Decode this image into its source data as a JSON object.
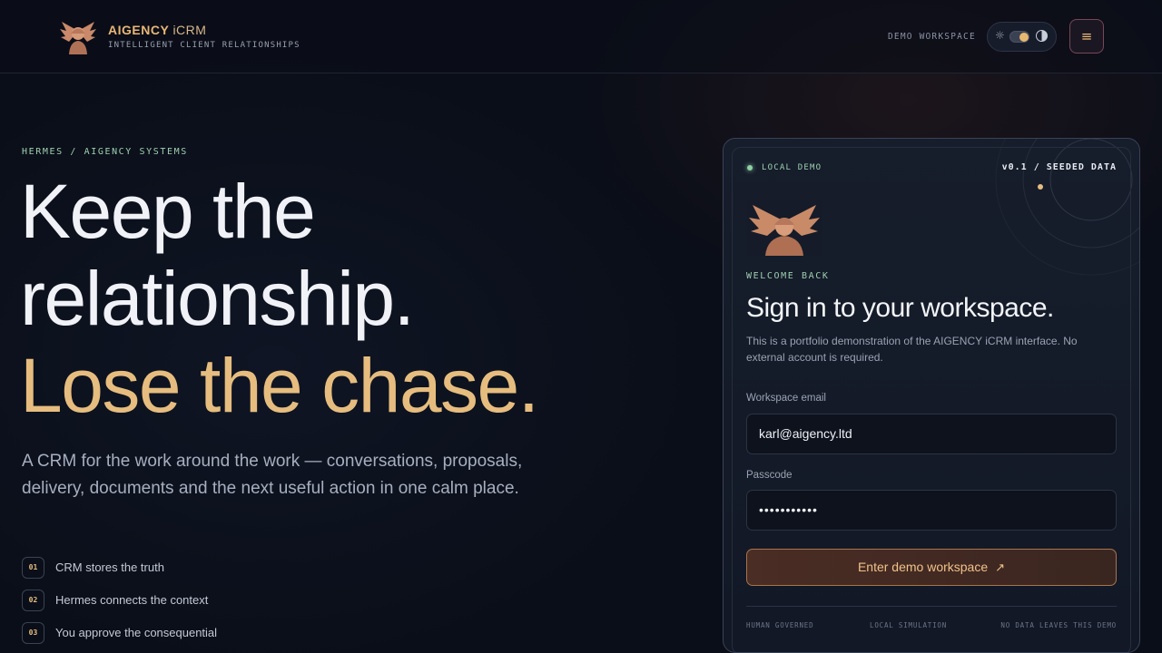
{
  "header": {
    "brand_main": "AIGENCY ",
    "brand_accent": "iCRM",
    "brand_sub": "INTELLIGENT CLIENT RELATIONSHIPS",
    "workspace_label": "DEMO WORKSPACE",
    "menu_glyph": "≡",
    "sun_glyph": "☼",
    "logo_icon": "winged-helmet-bust"
  },
  "hero": {
    "eyebrow": "HERMES / AIGENCY SYSTEMS",
    "line1": "Keep the",
    "line2": "relationship.",
    "line3": "Lose the chase.",
    "lede": "A CRM for the work around the work — conversations, proposals, delivery, documents and the next useful action in one calm place.",
    "points": [
      {
        "num": "01",
        "text": "CRM stores the truth"
      },
      {
        "num": "02",
        "text": "Hermes connects the context"
      },
      {
        "num": "03",
        "text": "You approve the consequential"
      }
    ]
  },
  "card": {
    "status": "LOCAL DEMO",
    "version": "v0.1 / SEEDED DATA",
    "welcome": "WELCOME BACK",
    "title": "Sign in to your workspace.",
    "description": "This is a portfolio demonstration of the AIGENCY iCRM interface. No external account is required.",
    "email_label": "Workspace email",
    "email_value": "karl@aigency.ltd",
    "passcode_label": "Passcode",
    "passcode_value": "•••••••••••",
    "submit_label": "Enter demo workspace",
    "submit_arrow": "↗",
    "footer": [
      "HUMAN GOVERNED",
      "LOCAL SIMULATION",
      "NO DATA LEAVES THIS DEMO"
    ]
  },
  "colors": {
    "background": "#0a0e18",
    "accent_gold": "#e6bd7f",
    "accent_green": "#9fd0b0",
    "menu_border": "#7a4656"
  }
}
